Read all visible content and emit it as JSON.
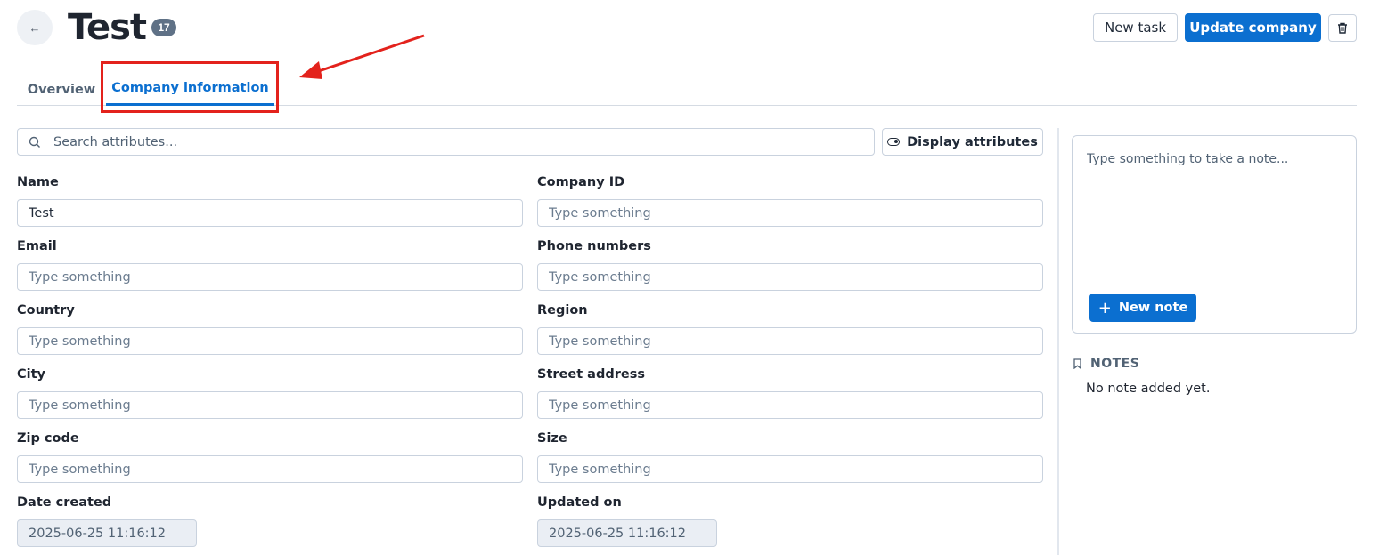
{
  "header": {
    "title": "Test",
    "count": "17",
    "new_task_label": "New task",
    "update_label": "Update company",
    "back_icon": "arrow-left-icon",
    "trash_icon": "trash-icon"
  },
  "tabs": [
    {
      "label": "Overview",
      "active": false
    },
    {
      "label": "Company information",
      "active": true
    }
  ],
  "search": {
    "placeholder": "Search attributes...",
    "display_attributes_label": "Display attributes"
  },
  "fields": {
    "name": {
      "label": "Name",
      "value": "Test",
      "placeholder": "Type something"
    },
    "company_id": {
      "label": "Company ID",
      "value": "",
      "placeholder": "Type something"
    },
    "email": {
      "label": "Email",
      "value": "",
      "placeholder": "Type something"
    },
    "phone_numbers": {
      "label": "Phone numbers",
      "value": "",
      "placeholder": "Type something"
    },
    "country": {
      "label": "Country",
      "value": "",
      "placeholder": "Type something"
    },
    "region": {
      "label": "Region",
      "value": "",
      "placeholder": "Type something"
    },
    "city": {
      "label": "City",
      "value": "",
      "placeholder": "Type something"
    },
    "street_address": {
      "label": "Street address",
      "value": "",
      "placeholder": "Type something"
    },
    "zip_code": {
      "label": "Zip code",
      "value": "",
      "placeholder": "Type something"
    },
    "size": {
      "label": "Size",
      "value": "",
      "placeholder": "Type something"
    },
    "date_created": {
      "label": "Date created",
      "value": "2025-06-25 11:16:12"
    },
    "updated_on": {
      "label": "Updated on",
      "value": "2025-06-25 11:16:12"
    }
  },
  "notes": {
    "placeholder": "Type something to take a note...",
    "new_note_label": "New note",
    "heading": "NOTES",
    "empty_text": "No note added yet."
  },
  "colors": {
    "primary": "#0b6fd0",
    "annotation": "#e3221c",
    "badge": "#5f7186"
  }
}
